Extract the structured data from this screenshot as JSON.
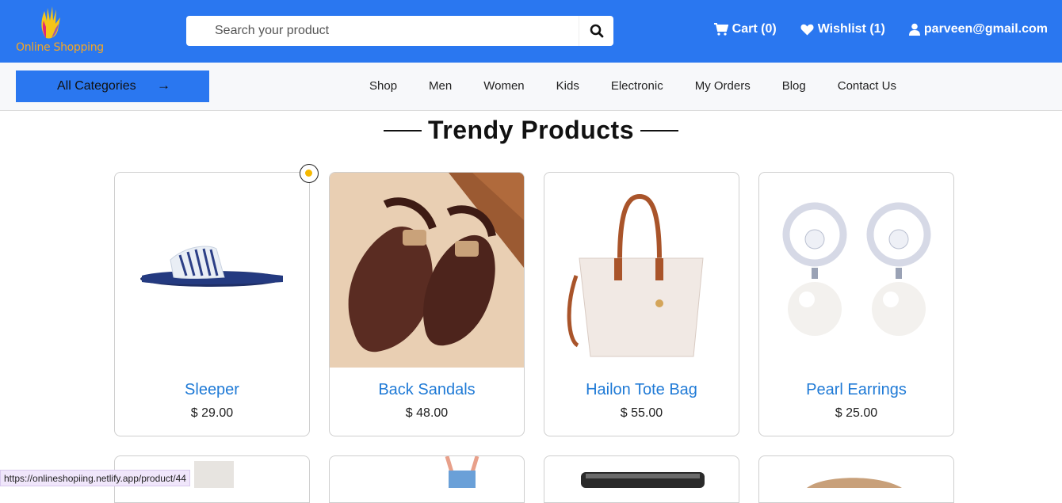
{
  "header": {
    "logo_text": "Online Shopping",
    "search_placeholder": "Search your product",
    "cart_label": "Cart (0)",
    "wishlist_label": "Wishlist (1)",
    "user_email": "parveen@gmail.com"
  },
  "nav": {
    "all_categories": "All Categories",
    "arrow": "→",
    "items": [
      "Shop",
      "Men",
      "Women",
      "Kids",
      "Electronic",
      "My Orders",
      "Blog",
      "Contact Us"
    ]
  },
  "section": {
    "title": "Trendy Products"
  },
  "products": [
    {
      "name": "Sleeper",
      "price": "$ 29.00"
    },
    {
      "name": "Back Sandals",
      "price": "$ 48.00"
    },
    {
      "name": "Hailon Tote Bag",
      "price": "$ 55.00"
    },
    {
      "name": "Pearl Earrings",
      "price": "$ 25.00"
    }
  ],
  "status_bar": {
    "url": "https://onlineshopiing.netlify.app/product/44"
  },
  "colors": {
    "brand": "#2a77f0",
    "link": "#1f7ad6",
    "nav_bg": "#f7f8fa"
  }
}
